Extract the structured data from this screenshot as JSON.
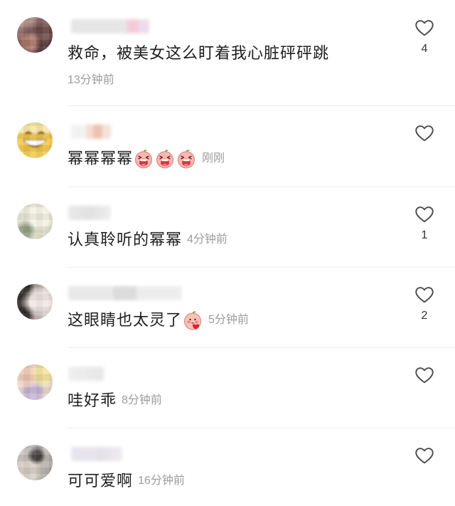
{
  "comments": [
    {
      "text": "救命，被美女这么盯着我心脏砰砰跳",
      "time": "13分钟前",
      "likes": "4",
      "emoji": []
    },
    {
      "text": "幂幂幂幂",
      "time": "刚刚",
      "emoji": [
        "laugh-cry-emoji",
        "laugh-cry-emoji",
        "laugh-cry-emoji"
      ]
    },
    {
      "text": "认真聆听的幂幂",
      "time": "4分钟前",
      "likes": "1",
      "emoji": []
    },
    {
      "text": "这眼睛也太灵了",
      "time": "5分钟前",
      "likes": "2",
      "emoji": [
        "blush-heart-emoji"
      ]
    },
    {
      "text": "哇好乖",
      "time": "8分钟前",
      "emoji": []
    },
    {
      "text": "可可爱啊",
      "time": "16分钟前",
      "emoji": []
    }
  ],
  "icons": {
    "like": "heart-outline-icon"
  }
}
